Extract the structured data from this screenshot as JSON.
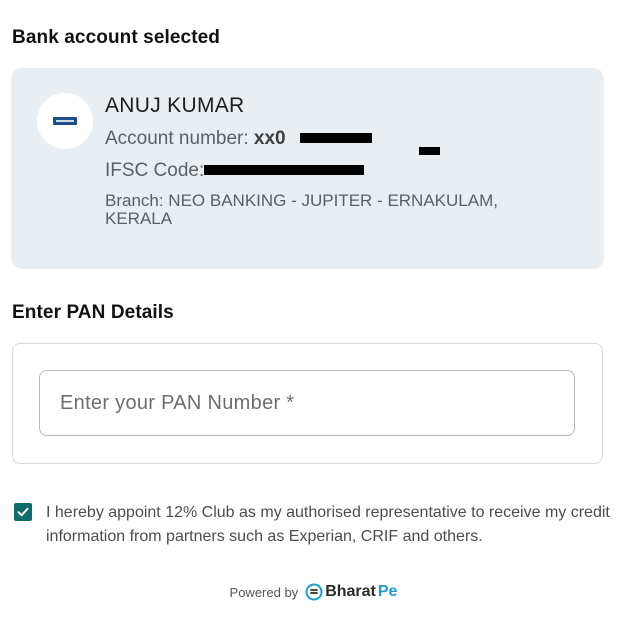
{
  "bank_section": {
    "title": "Bank account selected",
    "holder_name": "ANUJ KUMAR",
    "account_label": "Account number:",
    "account_value": "xx0",
    "ifsc_label": "IFSC Code:",
    "branch": "Branch: NEO BANKING - JUPITER - ERNAKULAM, KERALA"
  },
  "pan_section": {
    "title": "Enter PAN Details",
    "input_placeholder": "Enter your PAN Number *",
    "input_value": ""
  },
  "consent": {
    "checked": true,
    "text": "I hereby appoint 12% Club as my authorised representative to receive my credit information from partners such as Experian, CRIF and others."
  },
  "footer": {
    "powered_by": "Powered by",
    "brand_name_main": "Bharat",
    "brand_name_accent": "Pe"
  },
  "colors": {
    "card_background": "#e8eef1",
    "checkbox": "#116a6b",
    "brand_accent": "#1d9bd4"
  },
  "icons": {
    "bank_logo": "bank-logo-icon",
    "checkbox": "checkmark-icon",
    "brand": "bharatpe-logo-icon"
  }
}
